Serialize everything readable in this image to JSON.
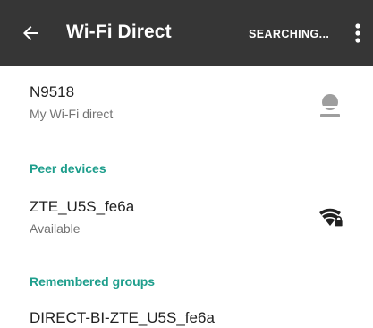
{
  "toolbar": {
    "back_icon": "arrow-back-icon",
    "title": "Wi-Fi Direct",
    "status": "SEARCHING...",
    "menu_icon": "more-vert-icon"
  },
  "this_device": {
    "name": "N9518",
    "subtitle": "My Wi-Fi direct",
    "icon": "person-icon"
  },
  "peer_devices": {
    "header": "Peer devices",
    "items": [
      {
        "name": "ZTE_U5S_fe6a",
        "status": "Available",
        "icon": "wifi-locked-icon"
      }
    ]
  },
  "remembered_groups": {
    "header": "Remembered groups",
    "items": [
      {
        "name": "DIRECT-BI-ZTE_U5S_fe6a"
      }
    ]
  },
  "colors": {
    "toolbar_bg": "#363636",
    "accent": "#1e9e8c",
    "primary_text": "#212121",
    "secondary_text": "#727272"
  }
}
